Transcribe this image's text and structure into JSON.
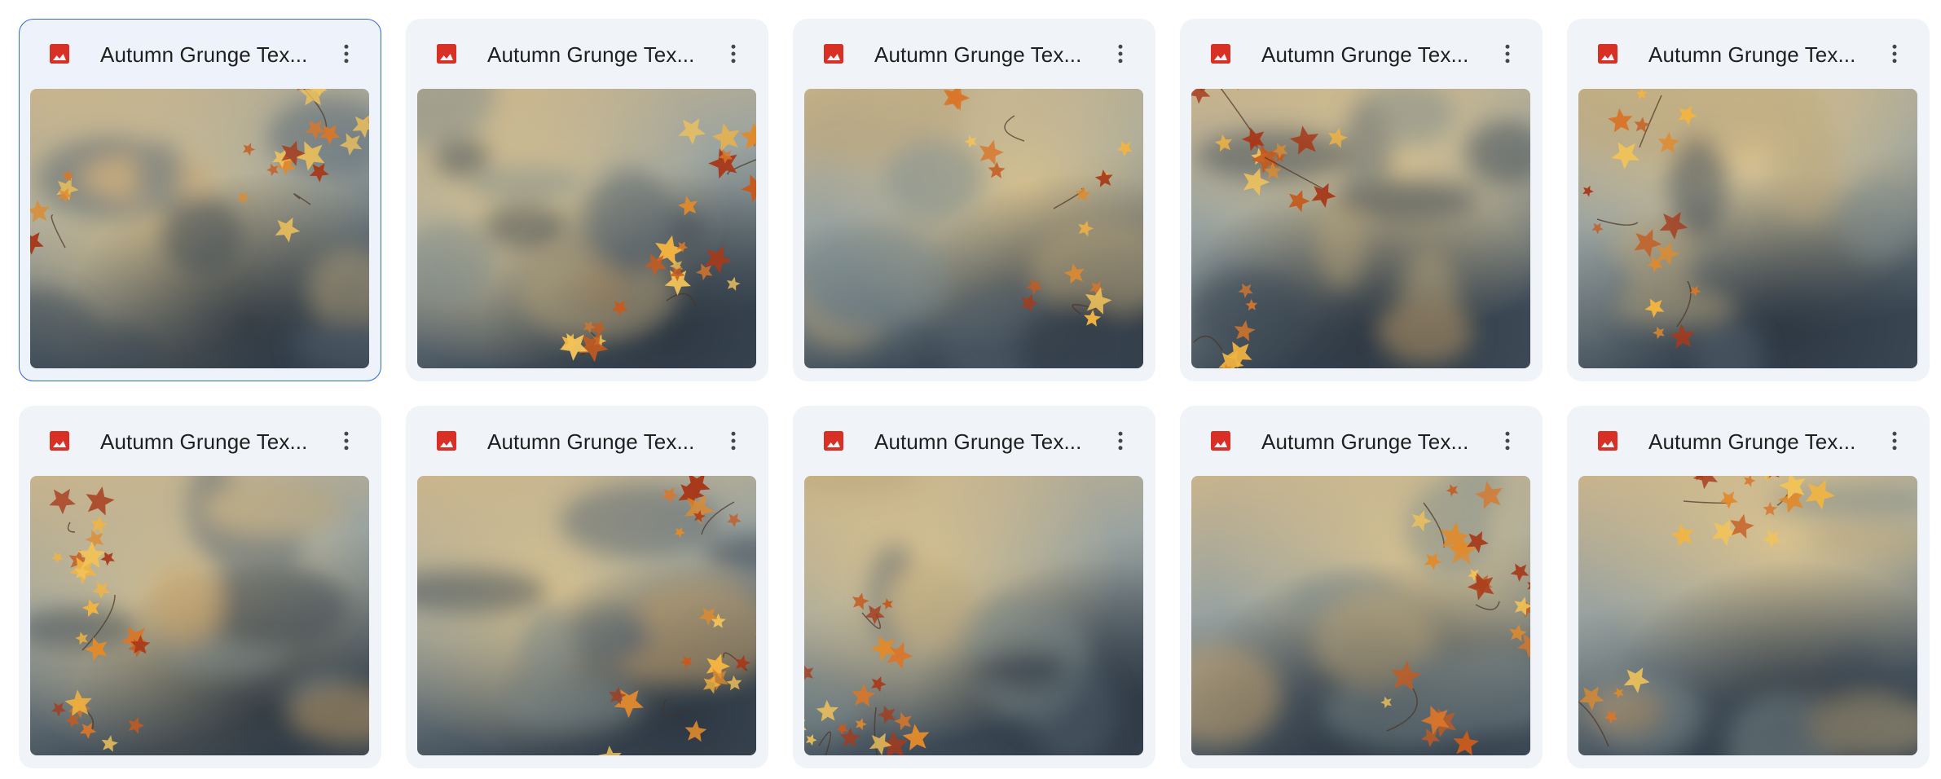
{
  "files": [
    {
      "title": "Autumn Grunge Tex...",
      "selected": true,
      "variant": 0
    },
    {
      "title": "Autumn Grunge Tex...",
      "selected": false,
      "variant": 1
    },
    {
      "title": "Autumn Grunge Tex...",
      "selected": false,
      "variant": 2
    },
    {
      "title": "Autumn Grunge Tex...",
      "selected": false,
      "variant": 3
    },
    {
      "title": "Autumn Grunge Tex...",
      "selected": false,
      "variant": 4
    },
    {
      "title": "Autumn Grunge Tex...",
      "selected": false,
      "variant": 5
    },
    {
      "title": "Autumn Grunge Tex...",
      "selected": false,
      "variant": 6
    },
    {
      "title": "Autumn Grunge Tex...",
      "selected": false,
      "variant": 7
    },
    {
      "title": "Autumn Grunge Tex...",
      "selected": false,
      "variant": 8
    },
    {
      "title": "Autumn Grunge Tex...",
      "selected": false,
      "variant": 9
    }
  ],
  "icons": {
    "file_type": "image-file-icon",
    "menu": "more-vert-icon"
  },
  "colors": {
    "card_background": "#f0f4f9",
    "selected_outline": "#2f6ad6",
    "image_icon": "#d93025",
    "title_text": "#1f1f1f"
  }
}
